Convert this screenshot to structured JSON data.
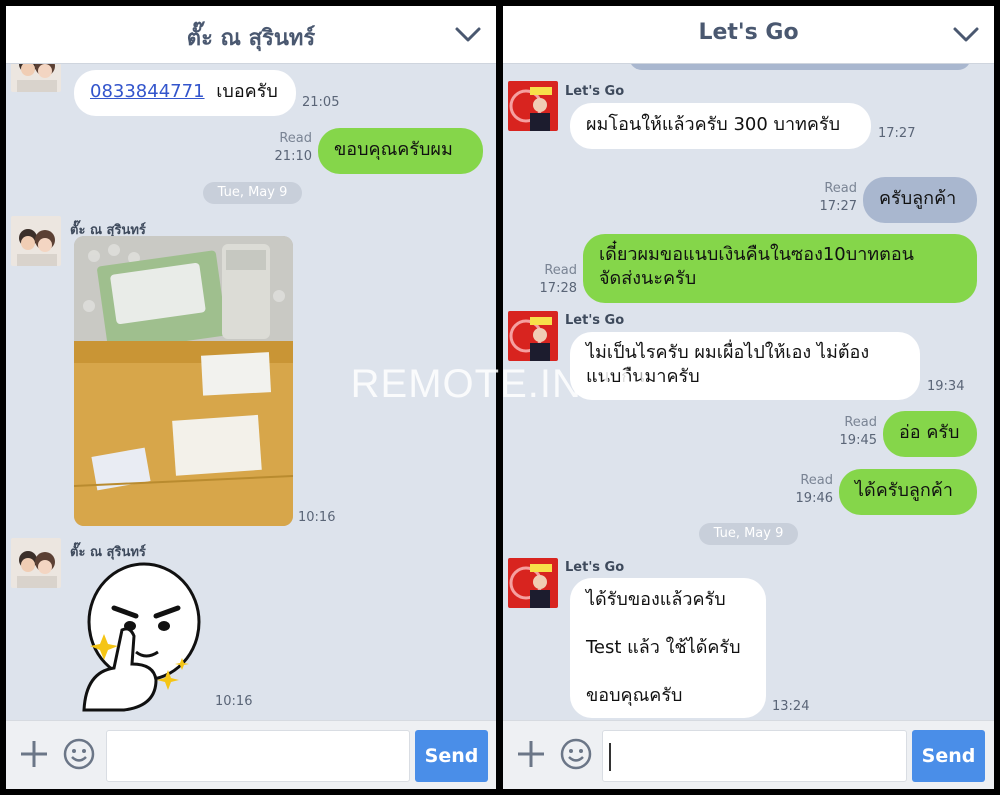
{
  "left": {
    "header": {
      "title": "ตั๊ะ ณ สุรินทร์"
    },
    "messages": {
      "m1_phone": "0833844771",
      "m1_rest": "เบอครับ",
      "m1_time": "21:05",
      "m2_read": "Read",
      "m2_time": "21:10",
      "m2_text": "ขอบคุณครับผม",
      "date": "Tue, May 9",
      "sender": "ตั๊ะ ณ สุรินทร์",
      "photo_time": "10:16",
      "sender2": "ตั๊ะ ณ สุรินทร์",
      "sticker_time": "10:16"
    },
    "input": {
      "send_label": "Send"
    }
  },
  "right": {
    "header": {
      "title": "Let's Go"
    },
    "messages": {
      "s1": "Let's Go",
      "r1_text": "ผมโอนให้แล้วครับ 300 บาทครับ",
      "r1_time": "17:27",
      "r2_read": "Read",
      "r2_time": "17:27",
      "r2_text": "ครับลูกค้า",
      "r3_read": "Read",
      "r3_time": "17:28",
      "r3_line1": "เดี๋ยวผมขอแนบเงินคืนในซอง10บาทตอน",
      "r3_line2": "จัดส่งนะครับ",
      "s2": "Let's Go",
      "r4_line1": "ไม่เป็นไรครับ ผมเผื่อไปให้เอง ไม่ต้อง",
      "r4_line2": "แนบกืนมาครับ",
      "r4_time": "19:34",
      "r5_read": "Read",
      "r5_time": "19:45",
      "r5_text": "อ่อ ครับ",
      "r6_read": "Read",
      "r6_time": "19:46",
      "r6_text": "ได้ครับลูกค้า",
      "date": "Tue, May 9",
      "s3": "Let's Go",
      "r7_line1": "ได้รับของแล้วครับ",
      "r7_line2": "Test แล้ว ใช้ได้ครับ",
      "r7_line3": "ขอบคุณครับ",
      "r7_time": "13:24"
    },
    "input": {
      "send_label": "Send"
    }
  },
  "watermark": "REMOTE.IN.TH",
  "colors": {
    "green_bubble": "#85d64a",
    "grey_bubble": "#a9b7cf",
    "send_button": "#4a8ee8",
    "chat_bg": "#dde3ec"
  }
}
